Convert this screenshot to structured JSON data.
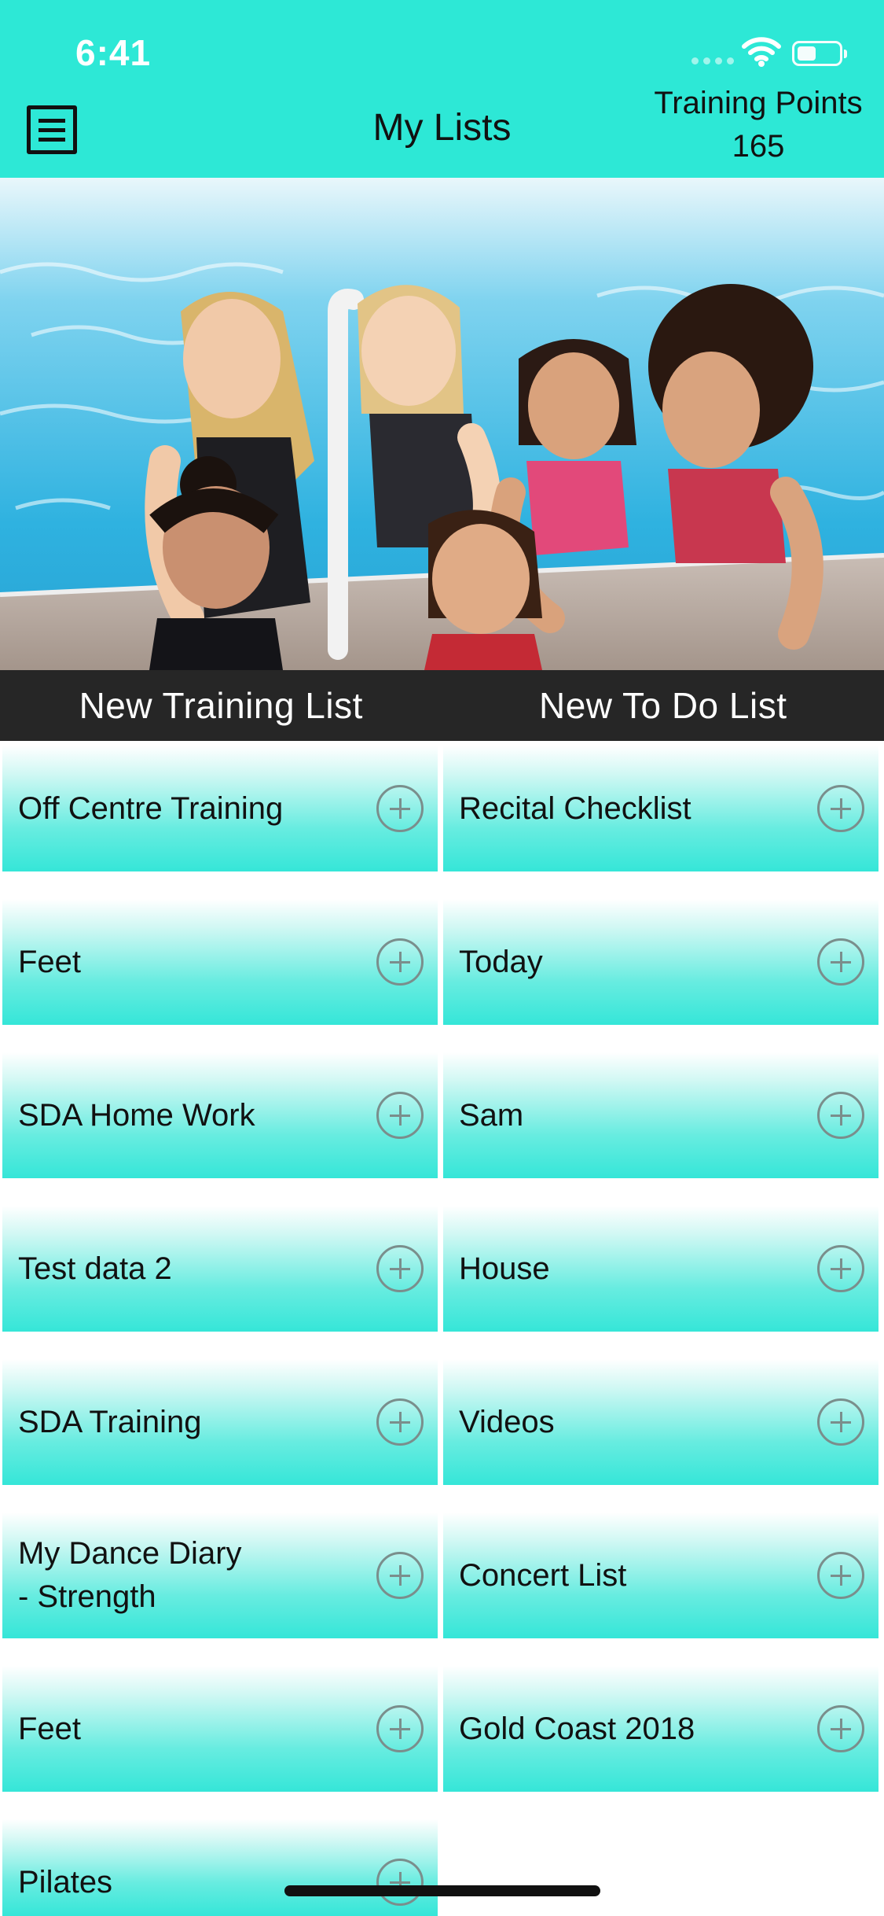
{
  "status_bar": {
    "time": "6:41",
    "battery_level": 0.45,
    "icons": [
      "cellular-icon",
      "wifi-icon",
      "battery-icon"
    ]
  },
  "header": {
    "menu_icon": "menu-icon",
    "title": "My Lists",
    "points_label": "Training Points",
    "points_value": "165"
  },
  "hero": {
    "image": "group-photo"
  },
  "actions": {
    "new_training_list": "New Training List",
    "new_todo_list": "New To Do List"
  },
  "training_lists": [
    {
      "label": "Off Centre Training"
    },
    {
      "label": "Feet"
    },
    {
      "label": "SDA Home Work"
    },
    {
      "label": "Test data 2"
    },
    {
      "label": "SDA Training"
    },
    {
      "label": "My Dance Diary\n- Strength"
    },
    {
      "label": "Feet"
    },
    {
      "label": "Pilates"
    }
  ],
  "todo_lists": [
    {
      "label": "Recital Checklist"
    },
    {
      "label": "Today"
    },
    {
      "label": "Sam"
    },
    {
      "label": "House"
    },
    {
      "label": "Videos"
    },
    {
      "label": "Concert List"
    },
    {
      "label": "Gold Coast 2018"
    }
  ],
  "theme": {
    "accent": "#2de8d6",
    "action_bar": "#262626",
    "text": "#111111"
  }
}
